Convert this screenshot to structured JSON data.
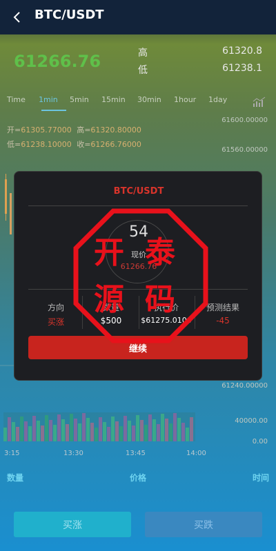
{
  "header": {
    "title": "BTC/USDT",
    "back_icon": "chevron-left-icon"
  },
  "ticker": {
    "price": "61266.76",
    "high_label": "高",
    "high_value": "61320.8",
    "low_label": "低",
    "low_value": "61238.1"
  },
  "tabs": [
    "Time",
    "1min",
    "5min",
    "15min",
    "30min",
    "1hour",
    "1day"
  ],
  "active_tab": "1min",
  "ohlc": {
    "open_label": "开=",
    "open": "61305.77000",
    "high_label": "高=",
    "high": "61320.80000",
    "low_label": "低=",
    "low": "61238.10000",
    "close_label": "收=",
    "close": "61266.76000"
  },
  "price_axis": [
    "61600.00000",
    "61560.00000",
    "61240.00000"
  ],
  "volume_axis": [
    "40000.00",
    "0.00"
  ],
  "time_axis": [
    "3:15",
    "13:30",
    "13:45",
    "14:00"
  ],
  "list_header": {
    "qty": "数量",
    "price": "价格",
    "time": "时间"
  },
  "actions": {
    "buy_up": "买涨",
    "buy_down": "买跌"
  },
  "modal": {
    "title": "BTC/USDT",
    "countdown": "54",
    "current_price_label": "现价",
    "current_price": "61266.76",
    "columns": [
      {
        "head": "方向",
        "value": "买涨"
      },
      {
        "head": "数量",
        "value": "$500"
      },
      {
        "head": "执行价",
        "value": "$61275.0100"
      },
      {
        "head": "预测结果",
        "value": "-45"
      }
    ],
    "continue_label": "继续"
  },
  "stamp": {
    "chars": [
      "开",
      "泰",
      "源",
      "码"
    ]
  },
  "colors": {
    "up": "#5fc04a",
    "down": "#d9342b",
    "accent": "#6cc5e0"
  }
}
